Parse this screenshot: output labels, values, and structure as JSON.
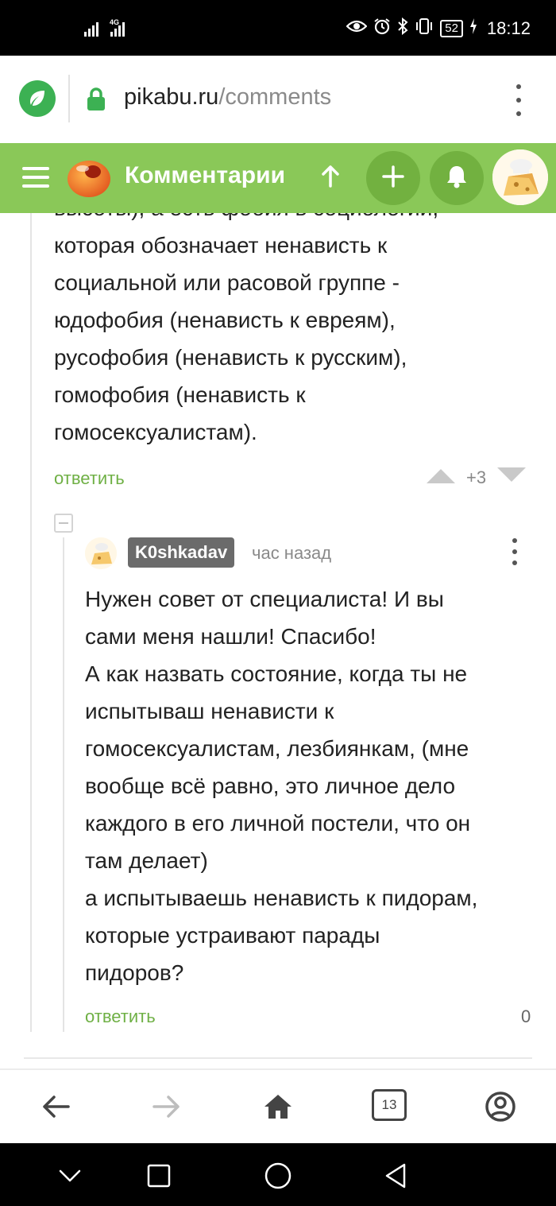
{
  "status_bar": {
    "network": "4G",
    "battery": "52",
    "time": "18:12"
  },
  "browser": {
    "url_domain": "pikabu.ru",
    "url_path": "/comments"
  },
  "header": {
    "title": "Комментарии"
  },
  "comment_parent": {
    "partial_text": "высоты), а есть фобия в социологии,\nкоторая обозначает ненависть к\nсоциальной или расовой группе -\nюдофобия (ненависть к евреям),\nрусофобия (ненависть к русским),\nгомофобия (ненависть к\nгомосексуалистам).",
    "reply_label": "ответить",
    "rating": "+3"
  },
  "comment_reply": {
    "author": "K0shkadav",
    "time_ago": "час назад",
    "text": "Нужен совет от специалиста! И вы\nсами меня нашли! Спасибо!\nА как назвать состояние, когда ты не\nиспытываш ненависти к\nгомосексуалистам, лезбиянкам, (мне\nвообще всё равно, это личное дело\nкаждого в его личной постели, что он\nтам делает)\nа испытываешь ненависть к пидорам,\nкоторые устраивают парады\nпидоров?",
    "reply_label": "ответить",
    "rating": "0"
  },
  "browser_nav": {
    "tab_count": "13"
  },
  "colors": {
    "brand_green": "#8ac858",
    "link_green": "#6fb045",
    "nick_bg": "#6b6b6b"
  },
  "icons": [
    "shield-icon",
    "lock-icon",
    "menu-icon",
    "pikabu-logo-icon",
    "arrow-up-icon",
    "plus-icon",
    "bell-icon",
    "avatar",
    "upvote-icon",
    "downvote-icon",
    "back-icon",
    "forward-icon",
    "home-icon",
    "tabs-icon",
    "account-icon",
    "sys-back-icon",
    "sys-home-icon",
    "sys-recents-icon"
  ]
}
